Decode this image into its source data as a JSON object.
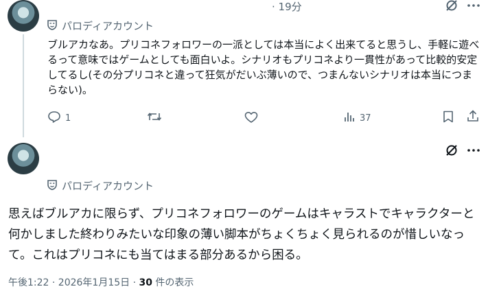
{
  "post1": {
    "time": "· 19分",
    "label": "パロディアカウント",
    "text": "ブルアカなあ。プリコネフォロワーの一派としては本当によく出来てると思うし、手軽に遊べるって意味ではゲームとしても面白いよ。シナリオもプリコネより一貫性があって比較的安定してるし(その分プリコネと違って狂気がだいぶ薄いので、つまんないシナリオは本当につまらない)。",
    "replies": "1",
    "views": "37"
  },
  "post2": {
    "label": "パロディアカウント",
    "text": "思えばブルアカに限らず、プリコネフォロワーのゲームはキャラストでキャラクターと何かしました終わりみたいな印象の薄い脚本がちょくちょく見られるのが惜しいなって。これはプリコネにも当てはまる部分あるから困る。",
    "timestamp": "午後1:22 · 2026年1月15日 · ",
    "views_count": "30",
    "views_suffix": " 件の表示"
  }
}
